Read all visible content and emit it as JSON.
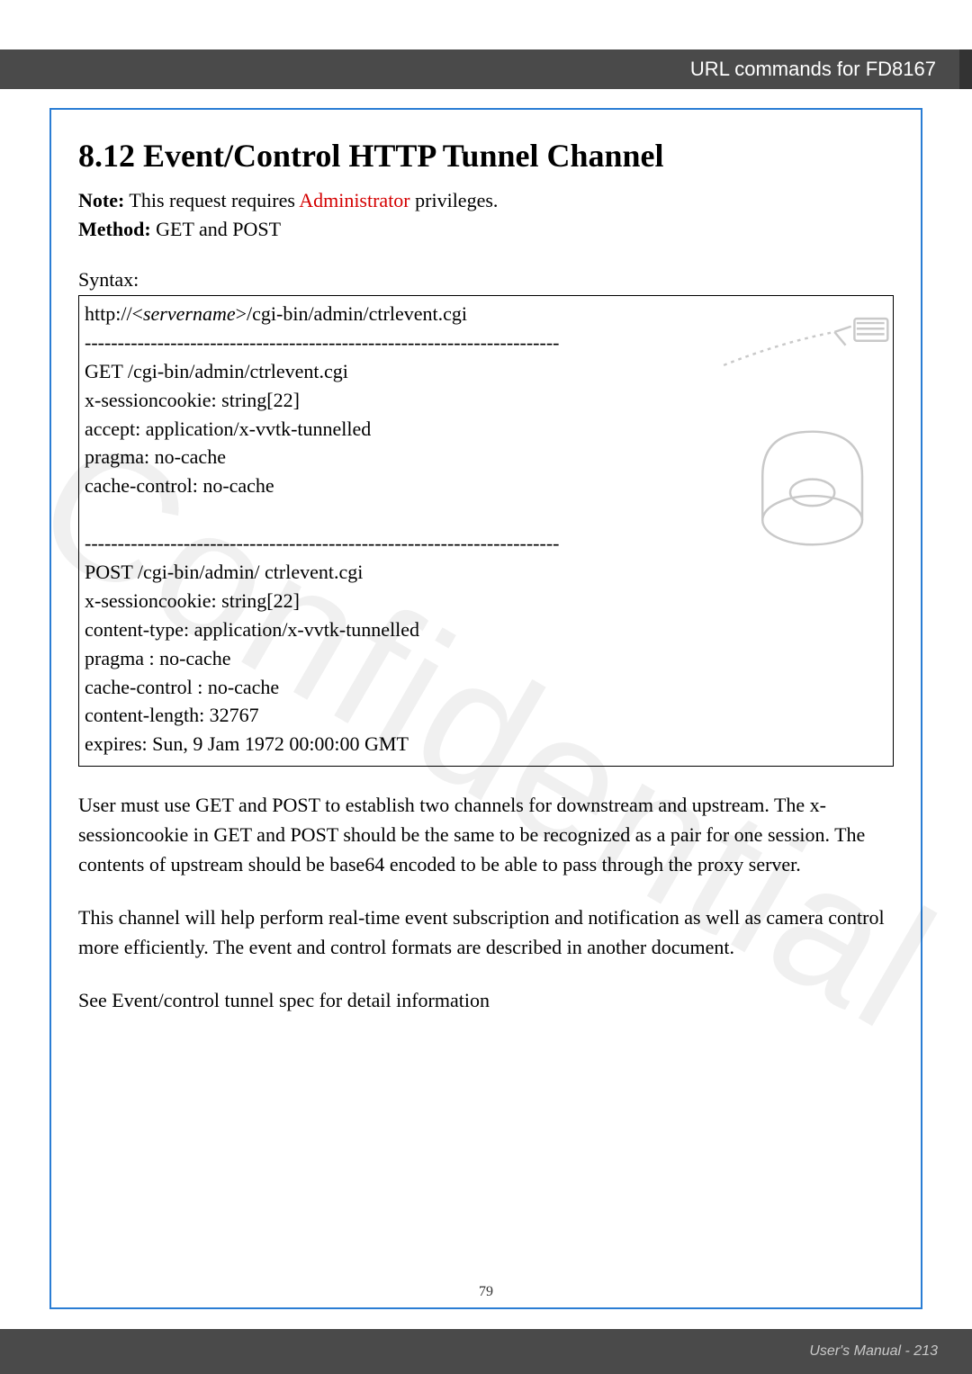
{
  "header": {
    "title": "URL commands for FD8167",
    "tab_char": ""
  },
  "section": {
    "title": "8.12 Event/Control HTTP Tunnel Channel"
  },
  "note": {
    "label": "Note:",
    "before": " This request requires ",
    "privword": "Administrator",
    "after": " privileges."
  },
  "method": {
    "label": "Method:",
    "value": " GET and POST"
  },
  "syntax": {
    "label": "Syntax:",
    "url_prefix": "http://<",
    "servername": "servername",
    "url_suffix": ">/cgi-bin/admin/ctrlevent.cgi",
    "dash": "------------------------------------------------------------------------",
    "get_block": [
      "GET /cgi-bin/admin/ctrlevent.cgi",
      "x-sessioncookie: string[22]",
      "accept: application/x-vvtk-tunnelled",
      "pragma: no-cache",
      "cache-control: no-cache"
    ],
    "post_block": [
      "POST /cgi-bin/admin/ ctrlevent.cgi",
      "x-sessioncookie: string[22]",
      "content-type: application/x-vvtk-tunnelled",
      "pragma : no-cache",
      "cache-control : no-cache",
      "content-length: 32767",
      "expires: Sun, 9 Jam 1972 00:00:00 GMT"
    ]
  },
  "paras": {
    "p1": "User must use GET and POST to establish two channels for downstream and upstream. The x-sessioncookie in GET and POST should be the same to be recognized as a pair for one session. The contents of upstream should be base64 encoded to be able to pass through the proxy server.",
    "p2": "This channel will help perform real-time event subscription and notification as well as camera control more efficiently. The event and control formats are described in another document.",
    "p3": "See Event/control tunnel spec for detail information"
  },
  "watermark": "Confidential",
  "inner_page": "79",
  "footer": "User's Manual - 213"
}
